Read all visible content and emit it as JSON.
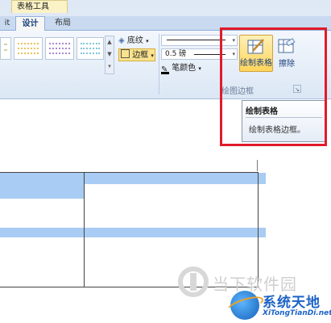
{
  "ribbon": {
    "context_tab": "表格工具",
    "tabs": [
      {
        "label": "it"
      },
      {
        "label": "设计",
        "active": true
      },
      {
        "label": "布局"
      }
    ],
    "shading_label": "底纹",
    "border_label": "边框",
    "line_weight_value": "0.5 磅",
    "pen_color_label": "笔颜色",
    "draw_table_label": "绘制表格",
    "eraser_label": "擦除",
    "group_label": "绘图边框"
  },
  "tooltip": {
    "title": "绘制表格",
    "description": "绘制表格边框。"
  },
  "watermark": {
    "site_name": "当下软件园",
    "brand": "系统天地",
    "url": "XiTongTianDi.net"
  },
  "colors": {
    "accent_highlight": "#e11a2a",
    "active_button": "#ffd45c",
    "table_shading": "#a8ccf3"
  }
}
